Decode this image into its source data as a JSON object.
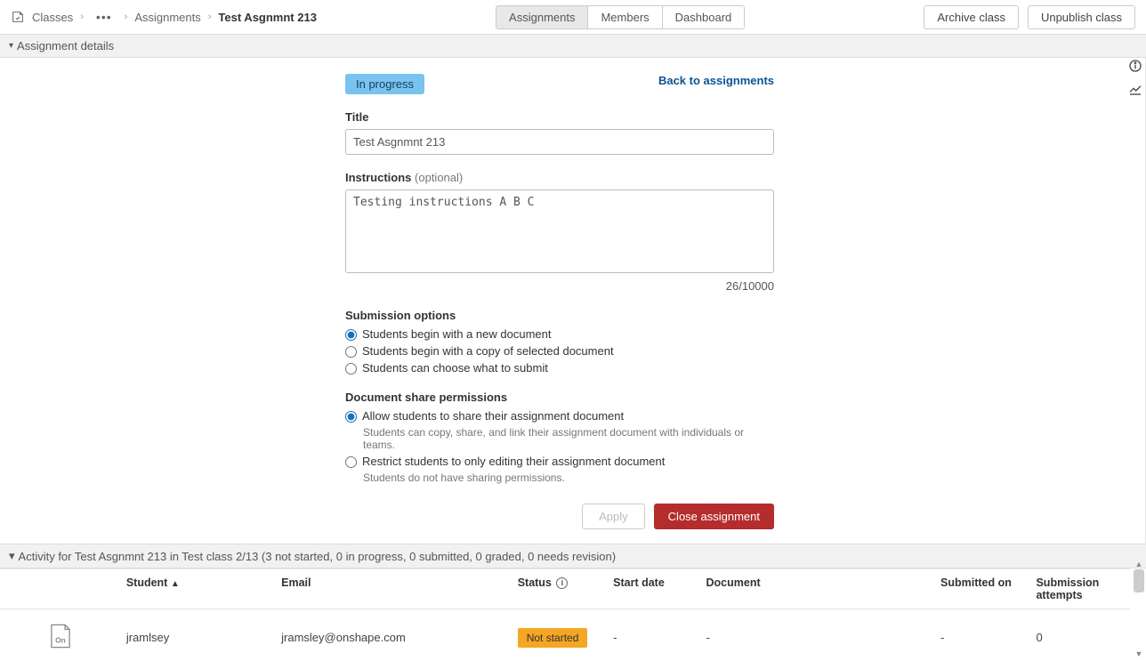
{
  "breadcrumb": {
    "root": "Classes",
    "mid": "Assignments",
    "current": "Test Asgnmnt 213"
  },
  "tabs": {
    "assignments": "Assignments",
    "members": "Members",
    "dashboard": "Dashboard"
  },
  "topActions": {
    "archive": "Archive class",
    "unpublish": "Unpublish class"
  },
  "sections": {
    "details": "Assignment details"
  },
  "form": {
    "status": "In progress",
    "backLink": "Back to assignments",
    "titleLabel": "Title",
    "titleValue": "Test Asgnmnt 213",
    "instructionsLabel": "Instructions",
    "instructionsOptional": "(optional)",
    "instructionsValue": "Testing instructions A B C",
    "counter": "26/10000",
    "submissionHeading": "Submission options",
    "submission": {
      "opt1": "Students begin with a new document",
      "opt2": "Students begin with a copy of selected document",
      "opt3": "Students can choose what to submit"
    },
    "shareHeading": "Document share permissions",
    "share": {
      "opt1": "Allow students to share their assignment document",
      "help1": "Students can copy, share, and link their assignment document with individuals or teams.",
      "opt2": "Restrict students to only editing their assignment document",
      "help2": "Students do not have sharing permissions."
    },
    "apply": "Apply",
    "close": "Close assignment"
  },
  "activity": {
    "heading": "Activity for Test Asgnmnt 213 in Test class 2/13 (3 not started, 0 in progress, 0 submitted, 0 graded, 0 needs revision)",
    "headers": {
      "student": "Student",
      "email": "Email",
      "status": "Status",
      "startDate": "Start date",
      "document": "Document",
      "submittedOn": "Submitted on",
      "attempts": "Submission attempts"
    },
    "rows": [
      {
        "student": "jramlsey",
        "email": "jramsley@onshape.com",
        "status": "Not started",
        "startDate": "-",
        "document": "-",
        "submittedOn": "-",
        "attempts": "0"
      }
    ]
  }
}
